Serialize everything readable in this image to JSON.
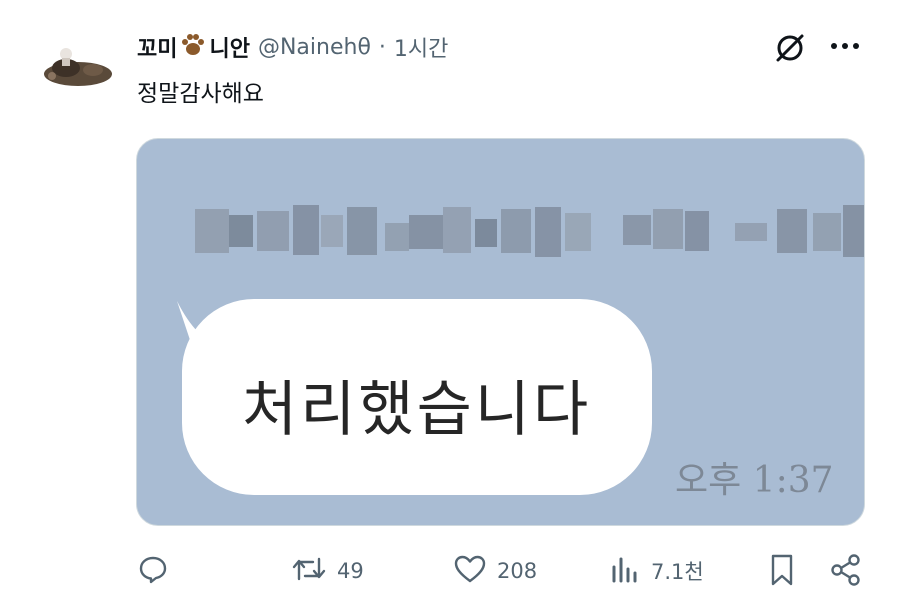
{
  "tweet": {
    "display_name": "꼬미",
    "display_name_suffix": "니안",
    "handle": "@Nainehθ",
    "separator": "·",
    "time": "1시간",
    "text": "정말감사해요"
  },
  "media": {
    "bubble_text": "처리했습니다",
    "timestamp": "오후 1:37"
  },
  "actions": {
    "reply_count": "",
    "retweet_count": "49",
    "like_count": "208",
    "views_count": "7.1천"
  },
  "icons": {
    "grok": "slashed-circle-icon",
    "more": "more-icon",
    "paw": "paw-emoji-icon",
    "reply": "reply-icon",
    "retweet": "retweet-icon",
    "like": "heart-icon",
    "views": "bar-chart-icon",
    "bookmark": "bookmark-icon",
    "share": "share-icon"
  },
  "colors": {
    "secondary_text": "#536471",
    "media_bg": "#a9bcd3"
  }
}
